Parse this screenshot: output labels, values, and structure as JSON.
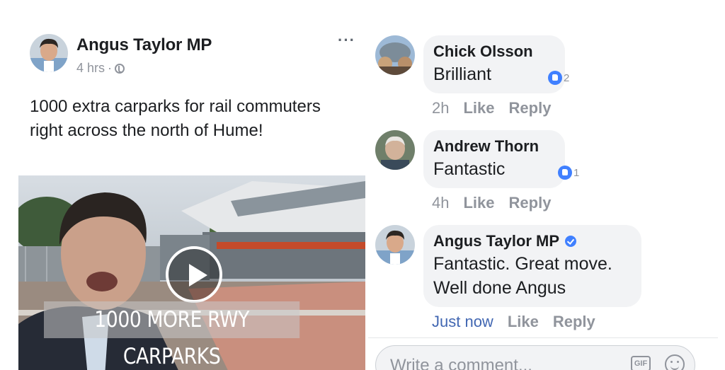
{
  "post": {
    "author": "Angus Taylor MP",
    "time": "4 hrs",
    "separator": "·",
    "text": "1000 extra carparks for rail commuters right across the north of Hume!",
    "video_caption": "1000 MORE RWY CARPARKS",
    "more_label": "···"
  },
  "comments": [
    {
      "author": "Chick Olsson",
      "text": "Brilliant",
      "reactions": "2",
      "time": "2h",
      "like": "Like",
      "reply": "Reply",
      "verified": false
    },
    {
      "author": "Andrew Thorn",
      "text": "Fantastic",
      "reactions": "1",
      "time": "4h",
      "like": "Like",
      "reply": "Reply",
      "verified": false
    },
    {
      "author": "Angus Taylor MP",
      "text_line1": "Fantastic. Great move.",
      "text_line2": "Well done Angus",
      "time": "Just now",
      "like": "Like",
      "reply": "Reply",
      "verified": true
    }
  ],
  "composer": {
    "placeholder": "Write a comment...",
    "gif_label": "GIF"
  },
  "colors": {
    "link_blue": "#4267b2",
    "reaction_blue": "#4080ff",
    "muted_gray": "#90949c",
    "bubble_bg": "#f2f3f5"
  }
}
